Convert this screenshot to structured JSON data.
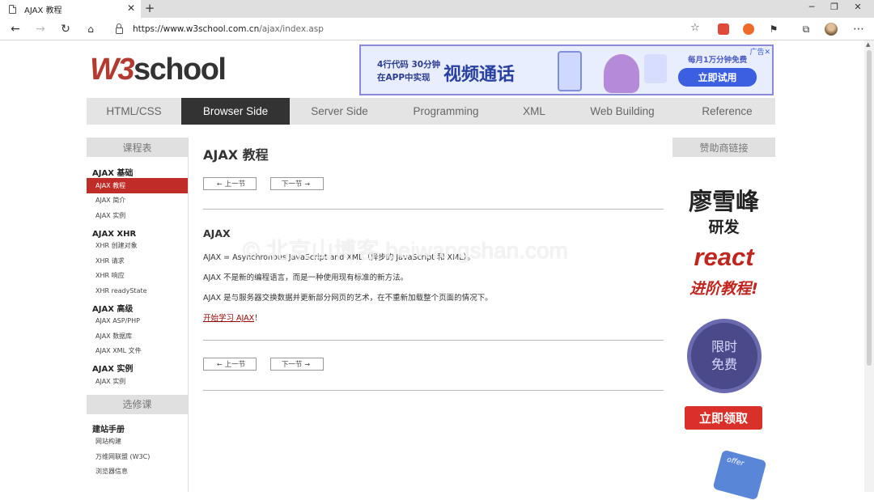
{
  "browser": {
    "tab_title": "AJAX 教程",
    "tab_close": "✕",
    "new_tab": "+",
    "url_host": "https://www.w3school.com.cn",
    "url_path": "/ajax/index.asp",
    "icons": [
      "back-icon",
      "forward-icon",
      "refresh-icon",
      "home-icon",
      "lock-icon",
      "star-icon",
      "collections-icon",
      "avatar",
      "more-icon"
    ]
  },
  "logo": {
    "w3": "W3",
    "school": "school"
  },
  "top_ad": {
    "line1": "4行代码  30分钟",
    "line2": "在APP中实现",
    "headline": "视频通话",
    "promo": "每月1万分钟免费",
    "cta": "立即试用",
    "tag": "广告✕"
  },
  "main_nav": [
    {
      "label": "HTML/CSS",
      "active": false
    },
    {
      "label": "Browser Side",
      "active": true
    },
    {
      "label": "Server Side",
      "active": false
    },
    {
      "label": "Programming",
      "active": false
    },
    {
      "label": "XML",
      "active": false
    },
    {
      "label": "Web Building",
      "active": false
    },
    {
      "label": "Reference",
      "active": false
    }
  ],
  "left_sidebar": {
    "header": "课程表",
    "groups": [
      {
        "title": "AJAX 基础",
        "items": [
          "AJAX 教程",
          "AJAX 简介",
          "AJAX 实例"
        ]
      },
      {
        "title": "AJAX XHR",
        "items": [
          "XHR 创建对象",
          "XHR 请求",
          "XHR 响应",
          "XHR readyState"
        ]
      },
      {
        "title": "AJAX 高级",
        "items": [
          "AJAX ASP/PHP",
          "AJAX 数据库",
          "AJAX XML 文件"
        ]
      },
      {
        "title": "AJAX 实例",
        "items": [
          "AJAX 实例"
        ]
      }
    ],
    "selected": "AJAX 教程",
    "elective_header": "选修课",
    "elective_group": "建站手册",
    "elective_items": [
      "网站构建",
      "万维网联盟 (W3C)",
      "浏览器信息"
    ]
  },
  "main": {
    "title": "AJAX 教程",
    "prev_label": "上一节",
    "next_label": "下一节",
    "section_title": "AJAX",
    "p1": "AJAX = Asynchronous JavaScript and XML（异步的 JavaScript 和 XML）。",
    "p2": "AJAX 不是新的编程语言，而是一种使用现有标准的新方法。",
    "p3": "AJAX 是与服务器交换数据并更新部分网页的艺术，在不重新加载整个页面的情况下。",
    "p4_link": "开始学习 AJAX",
    "p4_tail": "！",
    "watermark": "© 北京山博客 beiwangshan.com"
  },
  "right_sidebar": {
    "header": "赞助商链接",
    "ad_name": "廖雪峰",
    "ad_sub": "研发",
    "ad_react": "react",
    "ad_course": "进阶教程!",
    "ad_badge_1": "限时",
    "ad_badge_2": "免费",
    "ad_button": "立即领取",
    "ad_phone_text": "offer"
  }
}
